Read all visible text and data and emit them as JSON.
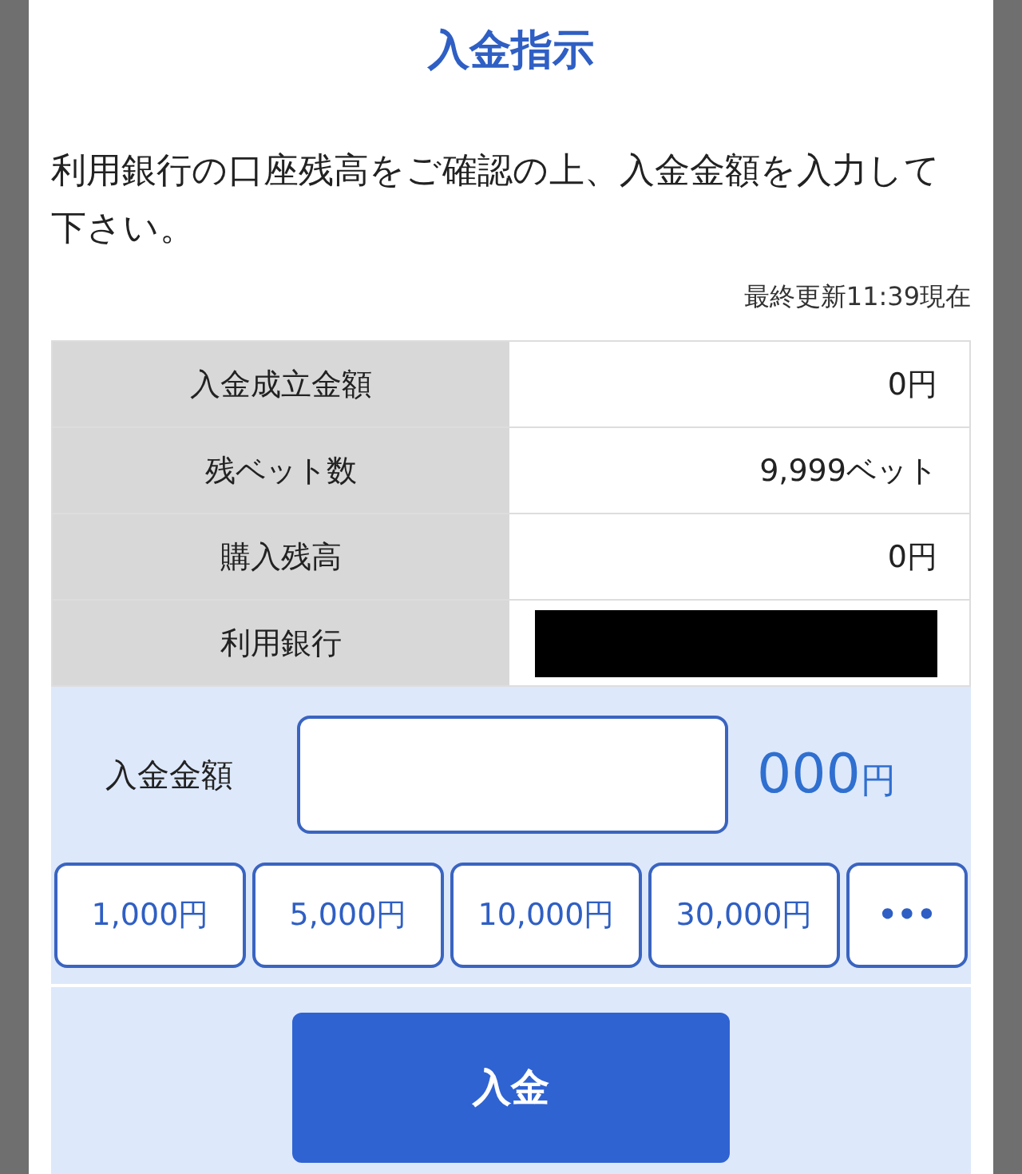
{
  "dialog": {
    "title": "入金指示",
    "message": "利用銀行の口座残高をご確認の上、入金金額を入力して下さい。",
    "updated": "最終更新11:39現在"
  },
  "table": {
    "rows": [
      {
        "label": "入金成立金額",
        "value": "0円",
        "kind": "text"
      },
      {
        "label": "残ベット数",
        "value": "9,999ベット",
        "kind": "text"
      },
      {
        "label": "購入残高",
        "value": "0円",
        "kind": "text"
      },
      {
        "label": "利用銀行",
        "kind": "redacted"
      }
    ]
  },
  "amount": {
    "label": "入金金額",
    "value": "000",
    "unit": "円"
  },
  "quick_buttons": [
    "1,000円",
    "5,000円",
    "10,000円",
    "30,000円",
    "•••"
  ],
  "submit": "入金"
}
